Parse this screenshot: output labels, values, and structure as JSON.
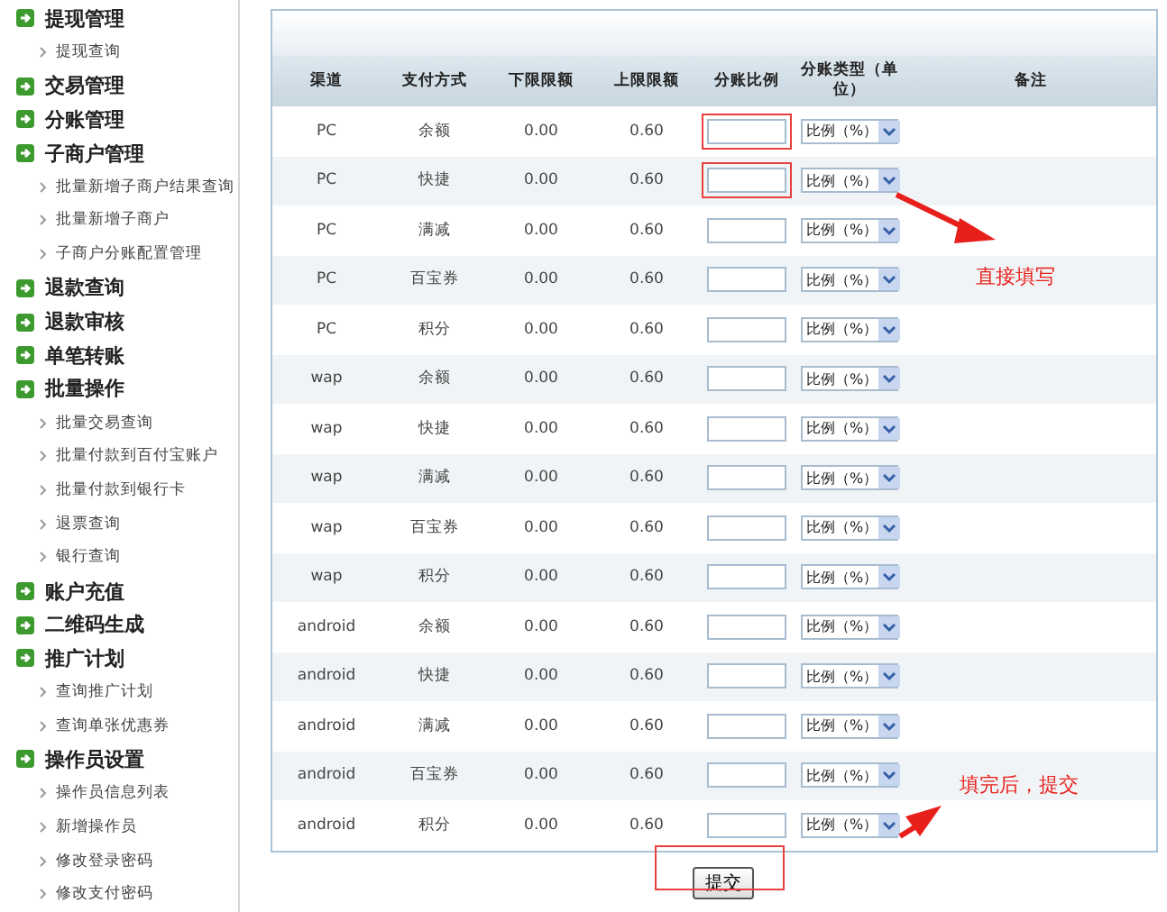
{
  "sidebar": {
    "sections": [
      {
        "label": "提现管理",
        "children": [
          {
            "label": "提现查询"
          }
        ]
      },
      {
        "label": "交易管理"
      },
      {
        "label": "分账管理"
      },
      {
        "label": "子商户管理",
        "children": [
          {
            "label": "批量新增子商户结果查询"
          },
          {
            "label": "批量新增子商户"
          },
          {
            "label": "子商户分账配置管理"
          }
        ]
      },
      {
        "label": "退款查询"
      },
      {
        "label": "退款审核"
      },
      {
        "label": "单笔转账"
      },
      {
        "label": "批量操作",
        "children": [
          {
            "label": "批量交易查询"
          },
          {
            "label": "批量付款到百付宝账户"
          },
          {
            "label": "批量付款到银行卡"
          },
          {
            "label": "退票查询"
          },
          {
            "label": "银行查询"
          }
        ]
      },
      {
        "label": "账户充值"
      },
      {
        "label": "二维码生成"
      },
      {
        "label": "推广计划",
        "children": [
          {
            "label": "查询推广计划"
          },
          {
            "label": "查询单张优惠券"
          }
        ]
      },
      {
        "label": "操作员设置",
        "children": [
          {
            "label": "操作员信息列表"
          },
          {
            "label": "新增操作员"
          },
          {
            "label": "修改登录密码"
          },
          {
            "label": "修改支付密码"
          }
        ]
      }
    ]
  },
  "table": {
    "columns": [
      "渠道",
      "支付方式",
      "下限限额",
      "上限限额",
      "分账比例",
      "分账类型（单位）",
      "备注"
    ],
    "rows": [
      {
        "channel": "PC",
        "method": "余额",
        "min": "0.00",
        "max": "0.60",
        "type": "比例（%）",
        "marked": true
      },
      {
        "channel": "PC",
        "method": "快捷",
        "min": "0.00",
        "max": "0.60",
        "type": "比例（%）",
        "marked": true
      },
      {
        "channel": "PC",
        "method": "满减",
        "min": "0.00",
        "max": "0.60",
        "type": "比例（%）",
        "marked": false
      },
      {
        "channel": "PC",
        "method": "百宝券",
        "min": "0.00",
        "max": "0.60",
        "type": "比例（%）",
        "marked": false
      },
      {
        "channel": "PC",
        "method": "积分",
        "min": "0.00",
        "max": "0.60",
        "type": "比例（%）",
        "marked": false
      },
      {
        "channel": "wap",
        "method": "余额",
        "min": "0.00",
        "max": "0.60",
        "type": "比例（%）",
        "marked": false
      },
      {
        "channel": "wap",
        "method": "快捷",
        "min": "0.00",
        "max": "0.60",
        "type": "比例（%）",
        "marked": false
      },
      {
        "channel": "wap",
        "method": "满减",
        "min": "0.00",
        "max": "0.60",
        "type": "比例（%）",
        "marked": false
      },
      {
        "channel": "wap",
        "method": "百宝券",
        "min": "0.00",
        "max": "0.60",
        "type": "比例（%）",
        "marked": false
      },
      {
        "channel": "wap",
        "method": "积分",
        "min": "0.00",
        "max": "0.60",
        "type": "比例（%）",
        "marked": false
      },
      {
        "channel": "android",
        "method": "余额",
        "min": "0.00",
        "max": "0.60",
        "type": "比例（%）",
        "marked": false
      },
      {
        "channel": "android",
        "method": "快捷",
        "min": "0.00",
        "max": "0.60",
        "type": "比例（%）",
        "marked": false
      },
      {
        "channel": "android",
        "method": "满减",
        "min": "0.00",
        "max": "0.60",
        "type": "比例（%）",
        "marked": false
      },
      {
        "channel": "android",
        "method": "百宝券",
        "min": "0.00",
        "max": "0.60",
        "type": "比例（%）",
        "marked": false
      },
      {
        "channel": "android",
        "method": "积分",
        "min": "0.00",
        "max": "0.60",
        "type": "比例（%）",
        "marked": false
      }
    ]
  },
  "submit_button": {
    "label": "提交"
  },
  "annotations": [
    {
      "text": "直接填写"
    },
    {
      "text": "填完后，提交"
    }
  ]
}
